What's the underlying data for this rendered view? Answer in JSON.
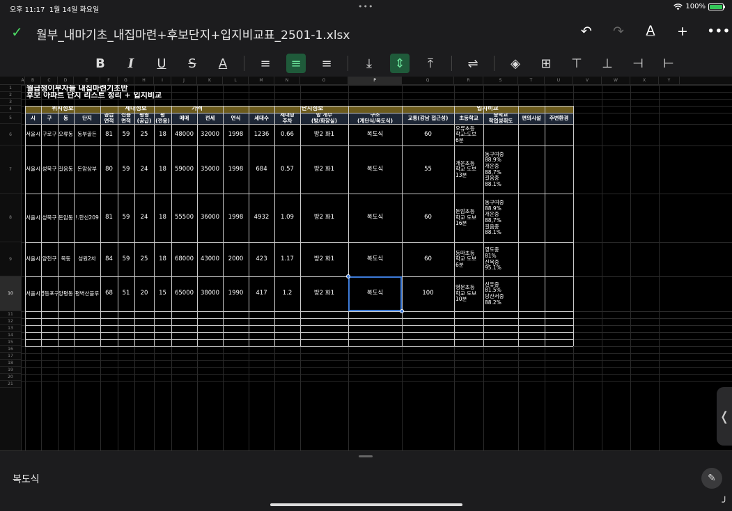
{
  "status": {
    "time": "오후 11:17",
    "date": "1월 14일 화요일",
    "dots": "•••",
    "battery": "100%",
    "battery_level": 1.0,
    "wifi_icon": "wifi-icon"
  },
  "titlebar": {
    "check_icon": "✓",
    "filename": "월부_내마기초_내집마련+후보단지+입지비교표_2501-1.xlsx",
    "undo": "↶",
    "redo": "↷",
    "text_format": "A",
    "add": "+",
    "more": "•••"
  },
  "toolbar": {
    "bold": "B",
    "italic": "I",
    "underline": "U",
    "strike": "S",
    "font_color": "A",
    "align_left": "≡",
    "align_center": "≡",
    "align_right": "≡",
    "valign_bottom": "⤓",
    "valign_middle": "⇕",
    "valign_top": "⤒",
    "wrap": "⇌",
    "fill": "◈",
    "borders": "⊞",
    "insert_row_above": "⊤",
    "insert_row_below": "⊥",
    "insert_col_left": "⊣",
    "insert_col_right": "⊢"
  },
  "columns": [
    "A",
    "B",
    "C",
    "D",
    "E",
    "F",
    "G",
    "H",
    "I",
    "J",
    "K",
    "L",
    "M",
    "N",
    "O",
    "P",
    "Q",
    "R",
    "S",
    "T",
    "U",
    "V",
    "W",
    "X",
    "Y"
  ],
  "selected_column": "P",
  "rows": [
    "1",
    "2",
    "3",
    "4",
    "5",
    "6",
    "7",
    "8",
    "9",
    "10",
    "11",
    "12",
    "13",
    "14",
    "15",
    "16",
    "17",
    "18",
    "19",
    "20",
    "21"
  ],
  "selected_row": "10",
  "sheet": {
    "title1": "월급쟁이부자들 내집마련기초반",
    "title2": "후보 아파트 단지 리스트 정리 + 입지비교",
    "groups": {
      "location": "위치정보",
      "household": "세대정보",
      "price": "가격",
      "complex": "단지정보",
      "compare": "입지비교"
    },
    "headers": {
      "si": "시",
      "gu": "구",
      "dong": "동",
      "danji": "단지",
      "supply_area": "공급\n면적",
      "exclusive_area": "전용\n면적",
      "pyeong_supply": "평형\n(공급)",
      "pyeong_excl": "평\n(전용)",
      "sale": "매매",
      "jeonse": "전세",
      "year": "연식",
      "units": "세대수",
      "parking": "세대당\n주차",
      "rooms": "방 개수\n(방/화장실)",
      "structure": "구조\n(계단식/복도식)",
      "traffic": "교통(강남 접근성)",
      "elementary": "초등학교",
      "middle": "중학교\n학업성취도",
      "convenience": "편의시설",
      "environment": "주변환경"
    },
    "data": [
      {
        "si": "서울시",
        "gu": "구로구",
        "dong": "오류동",
        "danji": "동부골든",
        "supply": "81",
        "excl": "59",
        "py_s": "25",
        "py_e": "18",
        "sale": "48000",
        "jeonse": "32000",
        "year": "1998",
        "units": "1236",
        "parking": "0.66",
        "rooms": "방2 화1",
        "structure": "복도식",
        "traffic": "60",
        "elementary": "오류초등\n학교:도보\n6분",
        "middle": ""
      },
      {
        "si": "서울시",
        "gu": "성북구",
        "dong": "길음동",
        "danji": "돈암삼부",
        "supply": "80",
        "excl": "59",
        "py_s": "24",
        "py_e": "18",
        "sale": "59000",
        "jeonse": "35000",
        "year": "1998",
        "units": "684",
        "parking": "0.57",
        "rooms": "방2 화1",
        "structure": "복도식",
        "traffic": "55",
        "elementary": "개운초등\n학교 도보\n13분",
        "middle": "동구여중\n88.9%\n개운중\n88,7%\n길음중\n88.1%"
      },
      {
        "si": "서울시",
        "gu": "성북구",
        "dong": "돈암동",
        "danji": "!.한신209",
        "supply": "81",
        "excl": "59",
        "py_s": "24",
        "py_e": "18",
        "sale": "55500",
        "jeonse": "36000",
        "year": "1998",
        "units": "4932",
        "parking": "1.09",
        "rooms": "방2 화1",
        "structure": "복도식",
        "traffic": "60",
        "elementary": "돈암초등\n학교 도보\n16분",
        "middle": "동구여중\n88.9%\n개운중\n88,7%\n길음중\n88.1%"
      },
      {
        "si": "서울시",
        "gu": "양천구",
        "dong": "목동",
        "danji": "성원2차",
        "supply": "84",
        "excl": "59",
        "py_s": "25",
        "py_e": "18",
        "sale": "68000",
        "jeonse": "43000",
        "year": "2000",
        "units": "423",
        "parking": "1.17",
        "rooms": "방2 화1",
        "structure": "복도식",
        "traffic": "60",
        "elementary": "등마초등\n학교 도보\n6분",
        "middle": "영도중\n81%\n신목중\n95.1%"
      },
      {
        "si": "서울시",
        "gu": "영등포구",
        "dong": "양평동",
        "danji": "평벽산블루",
        "supply": "68",
        "excl": "51",
        "py_s": "20",
        "py_e": "15",
        "sale": "65000",
        "jeonse": "38000",
        "year": "1990",
        "units": "417",
        "parking": "1.2",
        "rooms": "방2 화1",
        "structure": "복도식",
        "traffic": "100",
        "elementary": "영문초등\n학교 도보\n10분",
        "middle": "선유중\n81.5%\n당산서중\n88.2%"
      }
    ]
  },
  "formula_bar": {
    "value": "복도식"
  },
  "colors": {
    "group_header": "#6b5a1c",
    "column_header": "#1d2635",
    "selection": "#3d7bd9",
    "accent_green": "#4cd964"
  }
}
